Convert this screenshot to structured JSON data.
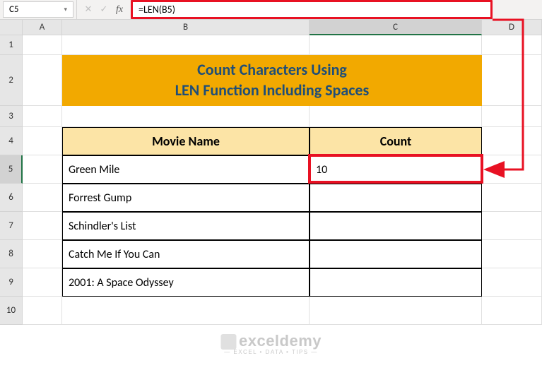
{
  "nameBox": "C5",
  "formula": "=LEN(B5)",
  "columns": [
    "",
    "A",
    "B",
    "C",
    "D"
  ],
  "rows": [
    "1",
    "2",
    "3",
    "4",
    "5",
    "6",
    "7",
    "8",
    "9",
    "10"
  ],
  "title": "Count Characters Using\nLEN Function Including Spaces",
  "headers": {
    "movie": "Movie Name",
    "count": "Count"
  },
  "data": [
    {
      "movie": "Green Mile",
      "count": "10"
    },
    {
      "movie": "Forrest Gump",
      "count": ""
    },
    {
      "movie": "Schindler's List",
      "count": ""
    },
    {
      "movie": "Catch  Me If You Can",
      "count": ""
    },
    {
      "movie": "2001: A Space Odyssey",
      "count": ""
    }
  ],
  "watermark": {
    "brand": "exceldemy",
    "tagline": "— EXCEL • DATA • TIPS —"
  },
  "chart_data": {
    "type": "table",
    "title": "Count Characters Using LEN Function Including Spaces",
    "columns": [
      "Movie Name",
      "Count"
    ],
    "rows": [
      [
        "Green Mile",
        10
      ],
      [
        "Forrest Gump",
        null
      ],
      [
        "Schindler's List",
        null
      ],
      [
        "Catch  Me If You Can",
        null
      ],
      [
        "2001: A Space Odyssey",
        null
      ]
    ]
  }
}
